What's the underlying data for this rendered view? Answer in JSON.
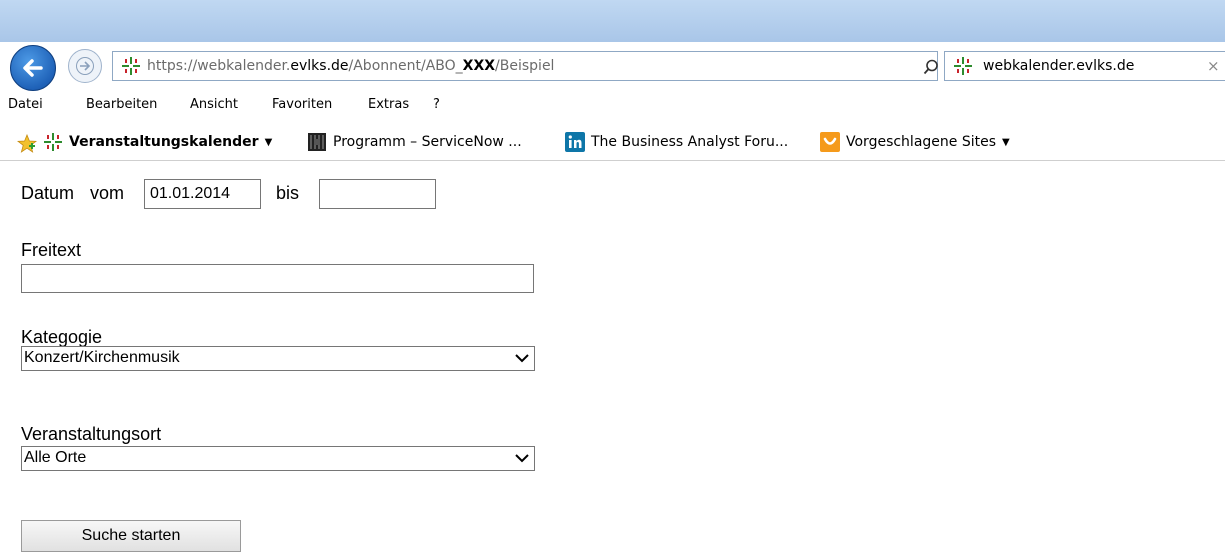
{
  "browser": {
    "url_prefix": "https://",
    "url_domain_start": "webkalender.",
    "url_domain_main": "evlks.de",
    "url_path_1": "/Abonnent/ABO_",
    "url_path_bold": "XXX",
    "url_path_2": "/Beispiel",
    "tab_title": "webkalender.evlks.de",
    "tab_close": "×"
  },
  "menu": {
    "items": [
      "Datei",
      "Bearbeiten",
      "Ansicht",
      "Favoriten",
      "Extras",
      "?"
    ]
  },
  "favorites": {
    "items": [
      {
        "label": "Veranstaltungskalender",
        "icon": "site-cross-icon"
      },
      {
        "label": "Programm – ServiceNow ...",
        "icon": "servicenow-icon"
      },
      {
        "label": "The Business Analyst Foru...",
        "icon": "linkedin-icon"
      },
      {
        "label": "Vorgeschlagene Sites",
        "icon": "bing-icon"
      }
    ],
    "dropdown_caret": "▼"
  },
  "form": {
    "date_label": "Datum",
    "from_label": "vom",
    "from_value": "01.01.2014",
    "to_label": "bis",
    "to_value": "",
    "freetext_label": "Freitext",
    "freetext_value": "",
    "category_label": "Kategogie",
    "category_value": "Konzert/Kirchenmusik",
    "location_label": "Veranstaltungsort",
    "location_value": "Alle Orte",
    "submit_label": "Suche starten"
  },
  "colors": {
    "accent_blue": "#1f62b8",
    "site_icon_green": "#2e8b2e",
    "site_icon_red": "#c8242b",
    "linkedin_blue": "#0e76a8",
    "bing_orange": "#f59a1b"
  }
}
